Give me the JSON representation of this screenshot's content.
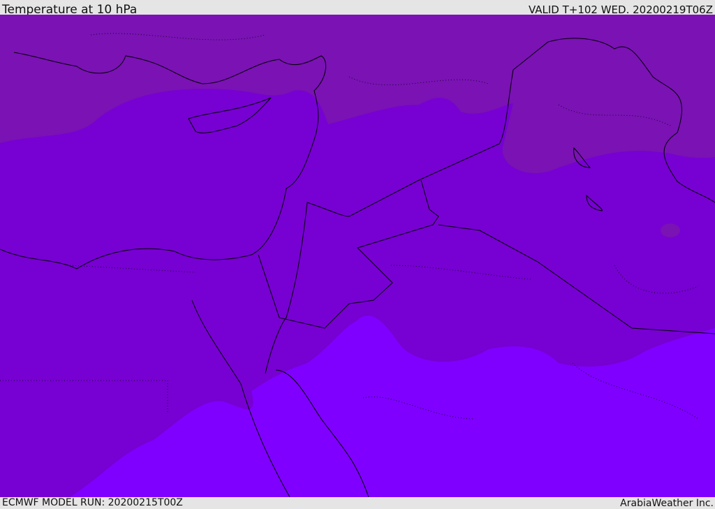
{
  "header": {
    "title": "Temperature at 10 hPa",
    "valid": "VALID T+102 WED. 20200219T06Z"
  },
  "footer": {
    "model_run": "ECMWF MODEL RUN: 20200215T00Z",
    "credit": "ArabiaWeather Inc."
  },
  "colors": {
    "band_cold": "#7a12b4",
    "band_mid": "#7700d2",
    "band_warm": "#7f00ff",
    "coast": "#000000"
  }
}
